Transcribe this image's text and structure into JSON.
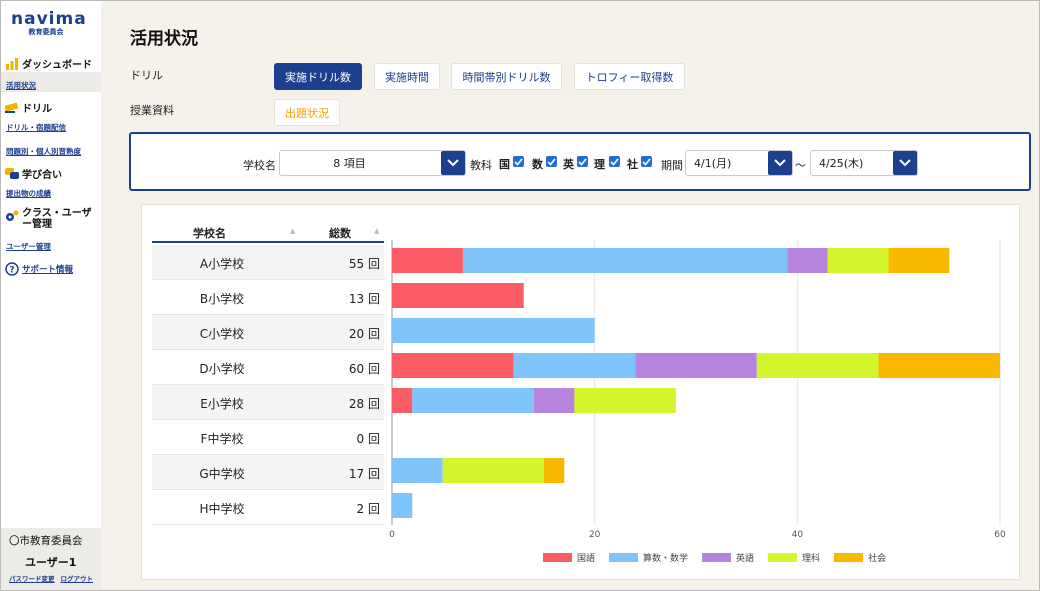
{
  "logo": {
    "name": "navima",
    "sub": "教育委員会"
  },
  "sidebar": {
    "dashboard": "ダッシュボード",
    "usage": "活用状況",
    "drill": "ドリル",
    "drill_link": "ドリル・宿題配信",
    "mastery_link": "問題別・個人別習熟度",
    "manabi": "学び合い",
    "submissions_link": "提出物の成績",
    "class_user": "クラス・ユーザー管理",
    "user_mgmt_link": "ユーザー管理",
    "support": "サポート情報"
  },
  "user": {
    "org": "〇市教育委員会",
    "name": "ユーザー1",
    "pw_change": "パスワード変更",
    "logout": "ログアウト"
  },
  "page": {
    "title": "活用状況",
    "drill_label": "ドリル",
    "materials_label": "授業資料",
    "tabs": [
      "実施ドリル数",
      "実施時間",
      "時間帯別ドリル数",
      "トロフィー取得数"
    ],
    "material_tab": "出題状況"
  },
  "filter": {
    "school_label": "学校名",
    "school_value": "8 項目",
    "subject_label": "教科",
    "subjects": [
      "国",
      "数",
      "英",
      "理",
      "社"
    ],
    "period_label": "期間",
    "date_from": "4/1(月)",
    "date_sep": "〜",
    "date_to": "4/25(木)"
  },
  "table": {
    "col_school": "学校名",
    "col_total": "総数",
    "unit": "回",
    "rows": [
      {
        "school": "A小学校",
        "total": "55"
      },
      {
        "school": "B小学校",
        "total": "13"
      },
      {
        "school": "C小学校",
        "total": "20"
      },
      {
        "school": "D小学校",
        "total": "60"
      },
      {
        "school": "E小学校",
        "total": "28"
      },
      {
        "school": "F中学校",
        "total": "0"
      },
      {
        "school": "G中学校",
        "total": "17"
      },
      {
        "school": "H中学校",
        "total": "2"
      }
    ]
  },
  "colors": {
    "primary": "#1d3f8f",
    "accent": "#f2a200"
  },
  "chart_data": {
    "type": "bar",
    "orientation": "horizontal",
    "stacked": true,
    "categories": [
      "A小学校",
      "B小学校",
      "C小学校",
      "D小学校",
      "E小学校",
      "F中学校",
      "G中学校",
      "H中学校"
    ],
    "xlim": [
      0,
      60
    ],
    "xticks": [
      "0",
      "20",
      "40",
      "60"
    ],
    "grid": true,
    "legend_position": "bottom",
    "series": [
      {
        "name": "国語",
        "color": "#fc5c65",
        "values": [
          7,
          13,
          0,
          12,
          2,
          0,
          0,
          0
        ]
      },
      {
        "name": "算数・数学",
        "color": "#7fc4fb",
        "values": [
          32,
          0,
          20,
          12,
          12,
          0,
          5,
          2
        ]
      },
      {
        "name": "英語",
        "color": "#b784dd",
        "values": [
          4,
          0,
          0,
          12,
          4,
          0,
          0,
          0
        ]
      },
      {
        "name": "理科",
        "color": "#d4f52c",
        "values": [
          6,
          0,
          0,
          12,
          10,
          0,
          10,
          0
        ]
      },
      {
        "name": "社会",
        "color": "#fbb800",
        "values": [
          6,
          0,
          0,
          12,
          0,
          0,
          2,
          0
        ]
      }
    ]
  }
}
